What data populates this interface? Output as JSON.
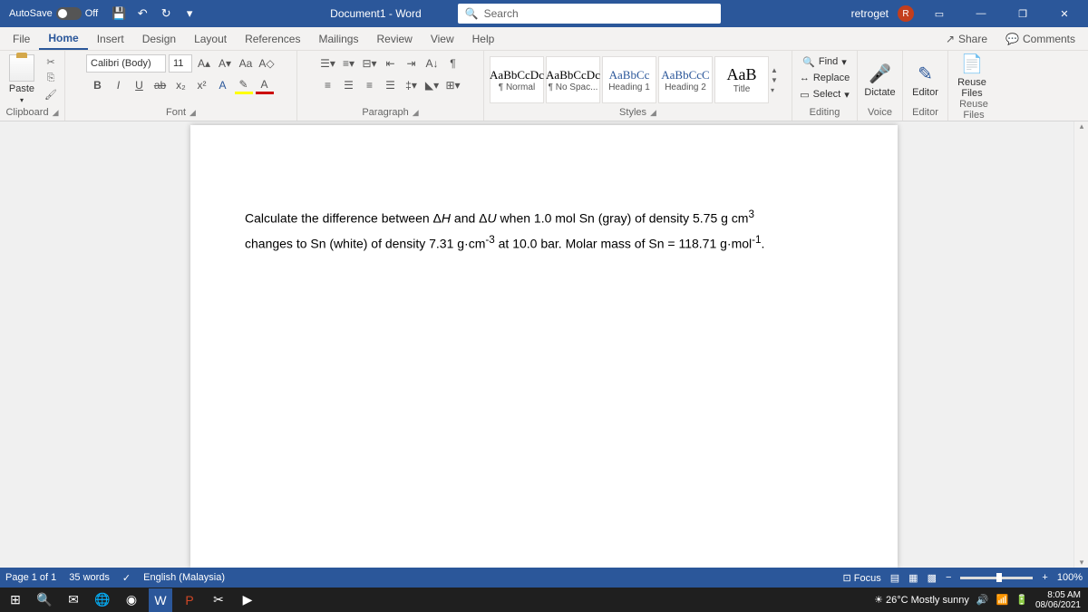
{
  "titlebar": {
    "autosave_label": "AutoSave",
    "autosave_state": "Off",
    "doc_title": "Document1 - Word",
    "search_placeholder": "Search",
    "username": "retroget",
    "avatar_initial": "R"
  },
  "tabs": {
    "items": [
      "File",
      "Home",
      "Insert",
      "Design",
      "Layout",
      "References",
      "Mailings",
      "Review",
      "View",
      "Help"
    ],
    "active": "Home",
    "share": "Share",
    "comments": "Comments"
  },
  "ribbon": {
    "clipboard": {
      "label": "Clipboard",
      "paste": "Paste"
    },
    "font": {
      "label": "Font",
      "name": "Calibri (Body)",
      "size": "11"
    },
    "paragraph": {
      "label": "Paragraph"
    },
    "styles": {
      "label": "Styles",
      "items": [
        {
          "preview": "AaBbCcDc",
          "name": "¶ Normal"
        },
        {
          "preview": "AaBbCcDc",
          "name": "¶ No Spac..."
        },
        {
          "preview": "AaBbCc",
          "name": "Heading 1"
        },
        {
          "preview": "AaBbCcC",
          "name": "Heading 2"
        },
        {
          "preview": "AaB",
          "name": "Title"
        }
      ]
    },
    "editing": {
      "label": "Editing",
      "find": "Find",
      "replace": "Replace",
      "select": "Select"
    },
    "voice": {
      "label": "Voice",
      "dictate": "Dictate"
    },
    "editor": {
      "label": "Editor",
      "btn": "Editor"
    },
    "reuse": {
      "label": "Reuse Files",
      "btn": "Reuse Files"
    }
  },
  "document": {
    "line1": "Calculate the difference between Δ<i>H</i> and Δ<i>U</i> when 1.0 mol Sn (gray) of density 5.75 g cm<sup>3</sup>",
    "line2": "changes to Sn (white) of density 7.31 g·cm<sup>-3</sup> at 10.0 bar. Molar mass of Sn = 118.71 g·mol<sup>-1</sup>."
  },
  "statusbar": {
    "page": "Page 1 of 1",
    "words": "35 words",
    "lang": "English (Malaysia)",
    "focus": "Focus",
    "zoom": "100%"
  },
  "taskbar": {
    "weather": "26°C Mostly sunny",
    "time": "8:05 AM",
    "date": "08/06/2021"
  }
}
